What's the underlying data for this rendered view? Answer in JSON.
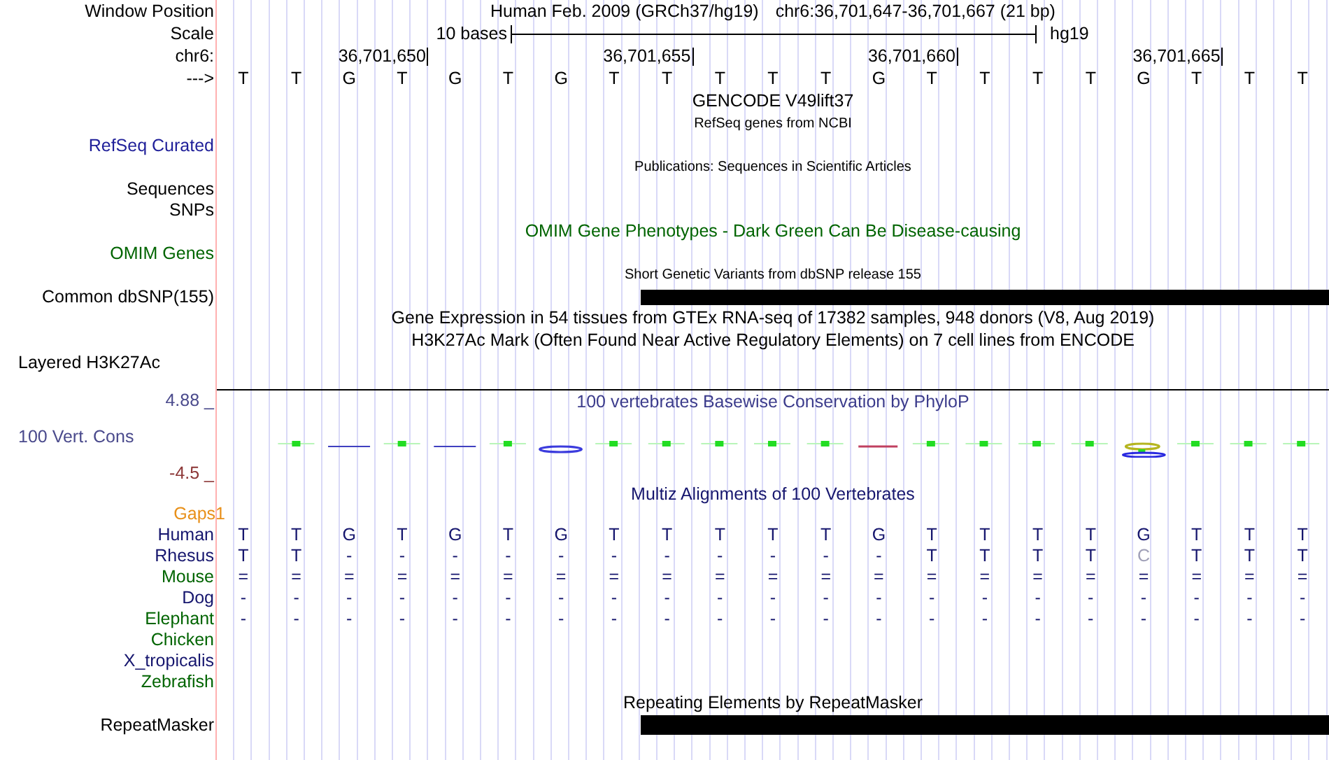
{
  "header": {
    "label": "Window Position",
    "title": "Human Feb. 2009 (GRCh37/hg19)",
    "position": "chr6:36,701,647-36,701,667 (21 bp)"
  },
  "scale": {
    "label": "Scale",
    "span": "10 bases",
    "assembly": "hg19"
  },
  "ruler": {
    "label": "chr6:",
    "ticks": [
      "36,701,650",
      "36,701,655",
      "36,701,660",
      "36,701,665"
    ]
  },
  "sequence": {
    "label": "--->",
    "bases": [
      "T",
      "T",
      "G",
      "T",
      "G",
      "T",
      "G",
      "T",
      "T",
      "T",
      "T",
      "T",
      "G",
      "T",
      "T",
      "T",
      "T",
      "G",
      "T",
      "T",
      "T"
    ]
  },
  "tracks": [
    {
      "kind": "title",
      "text": "GENCODE V49lift37",
      "color": "#000000"
    },
    {
      "kind": "small_title",
      "text": "RefSeq genes from NCBI",
      "color": "#000000"
    },
    {
      "kind": "label",
      "text": "RefSeq Curated",
      "color": "#1f1f99"
    },
    {
      "kind": "small_title",
      "text": "Publications: Sequences in Scientific Articles",
      "color": "#000000"
    },
    {
      "kind": "label",
      "text": "Sequences",
      "color": "#000000"
    },
    {
      "kind": "label",
      "text": "SNPs",
      "color": "#000000"
    },
    {
      "kind": "title",
      "text": "OMIM Gene Phenotypes - Dark Green Can Be Disease-causing",
      "color": "#006400"
    },
    {
      "kind": "label",
      "text": "OMIM Genes",
      "color": "#006400"
    },
    {
      "kind": "small_title",
      "text": "Short Genetic Variants from dbSNP release 155",
      "color": "#000000"
    },
    {
      "kind": "bar",
      "text": "Common dbSNP(155)",
      "color": "#000000"
    },
    {
      "kind": "title",
      "text": "Gene Expression in 54 tissues from GTEx RNA-seq of 17382 samples, 948 donors (V8, Aug 2019)",
      "color": "#000000"
    },
    {
      "kind": "title",
      "text": "H3K27Ac Mark (Often Found Near Active Regulatory Elements) on 7 cell lines from ENCODE",
      "color": "#000000"
    },
    {
      "kind": "left_label",
      "text": "Layered H3K27Ac",
      "color": "#000000"
    }
  ],
  "conservation": {
    "title": {
      "text": "100 vertebrates Basewise Conservation by PhyloP",
      "color": "#3c3c8c"
    },
    "label": {
      "text": "100 Vert. Cons",
      "color": "#4a4a8c"
    },
    "max": {
      "text": "4.88 _",
      "color": "#4a4a8c"
    },
    "min": {
      "text": "-4.5 _",
      "color": "#8b3535"
    }
  },
  "multiz": {
    "title": {
      "text": "Multiz Alignments of 100 Vertebrates",
      "color": "#16166e"
    },
    "gaps": {
      "text": "Gaps1",
      "color": "#e8901a"
    },
    "species": [
      {
        "name": "Human",
        "color": "#16166e",
        "bases": [
          "T",
          "T",
          "G",
          "T",
          "G",
          "T",
          "G",
          "T",
          "T",
          "T",
          "T",
          "T",
          "G",
          "T",
          "T",
          "T",
          "T",
          "G",
          "T",
          "T",
          "T"
        ]
      },
      {
        "name": "Rhesus",
        "color": "#16166e",
        "bases": [
          "T",
          "T",
          "-",
          "-",
          "-",
          "-",
          "-",
          "-",
          "-",
          "-",
          "-",
          "-",
          "-",
          "T",
          "T",
          "T",
          "T",
          "C",
          "T",
          "T",
          "T"
        ]
      },
      {
        "name": "Mouse",
        "color": "#006400",
        "bases": [
          "=",
          "=",
          "=",
          "=",
          "=",
          "=",
          "=",
          "=",
          "=",
          "=",
          "=",
          "=",
          "=",
          "=",
          "=",
          "=",
          "=",
          "=",
          "=",
          "=",
          "="
        ]
      },
      {
        "name": "Dog",
        "color": "#16166e",
        "bases": [
          "-",
          "-",
          "-",
          "-",
          "-",
          "-",
          "-",
          "-",
          "-",
          "-",
          "-",
          "-",
          "-",
          "-",
          "-",
          "-",
          "-",
          "-",
          "-",
          "-",
          "-"
        ]
      },
      {
        "name": "Elephant",
        "color": "#006400",
        "bases": [
          "-",
          "-",
          "-",
          "-",
          "-",
          "-",
          "-",
          "-",
          "-",
          "-",
          "-",
          "-",
          "-",
          "-",
          "-",
          "-",
          "-",
          "-",
          "-",
          "-",
          "-"
        ]
      },
      {
        "name": "Chicken",
        "color": "#006400"
      },
      {
        "name": "X_tropicalis",
        "color": "#16166e"
      },
      {
        "name": "Zebrafish",
        "color": "#006400"
      }
    ]
  },
  "repeats": {
    "title": "Repeating Elements by RepeatMasker",
    "label": "RepeatMasker"
  }
}
